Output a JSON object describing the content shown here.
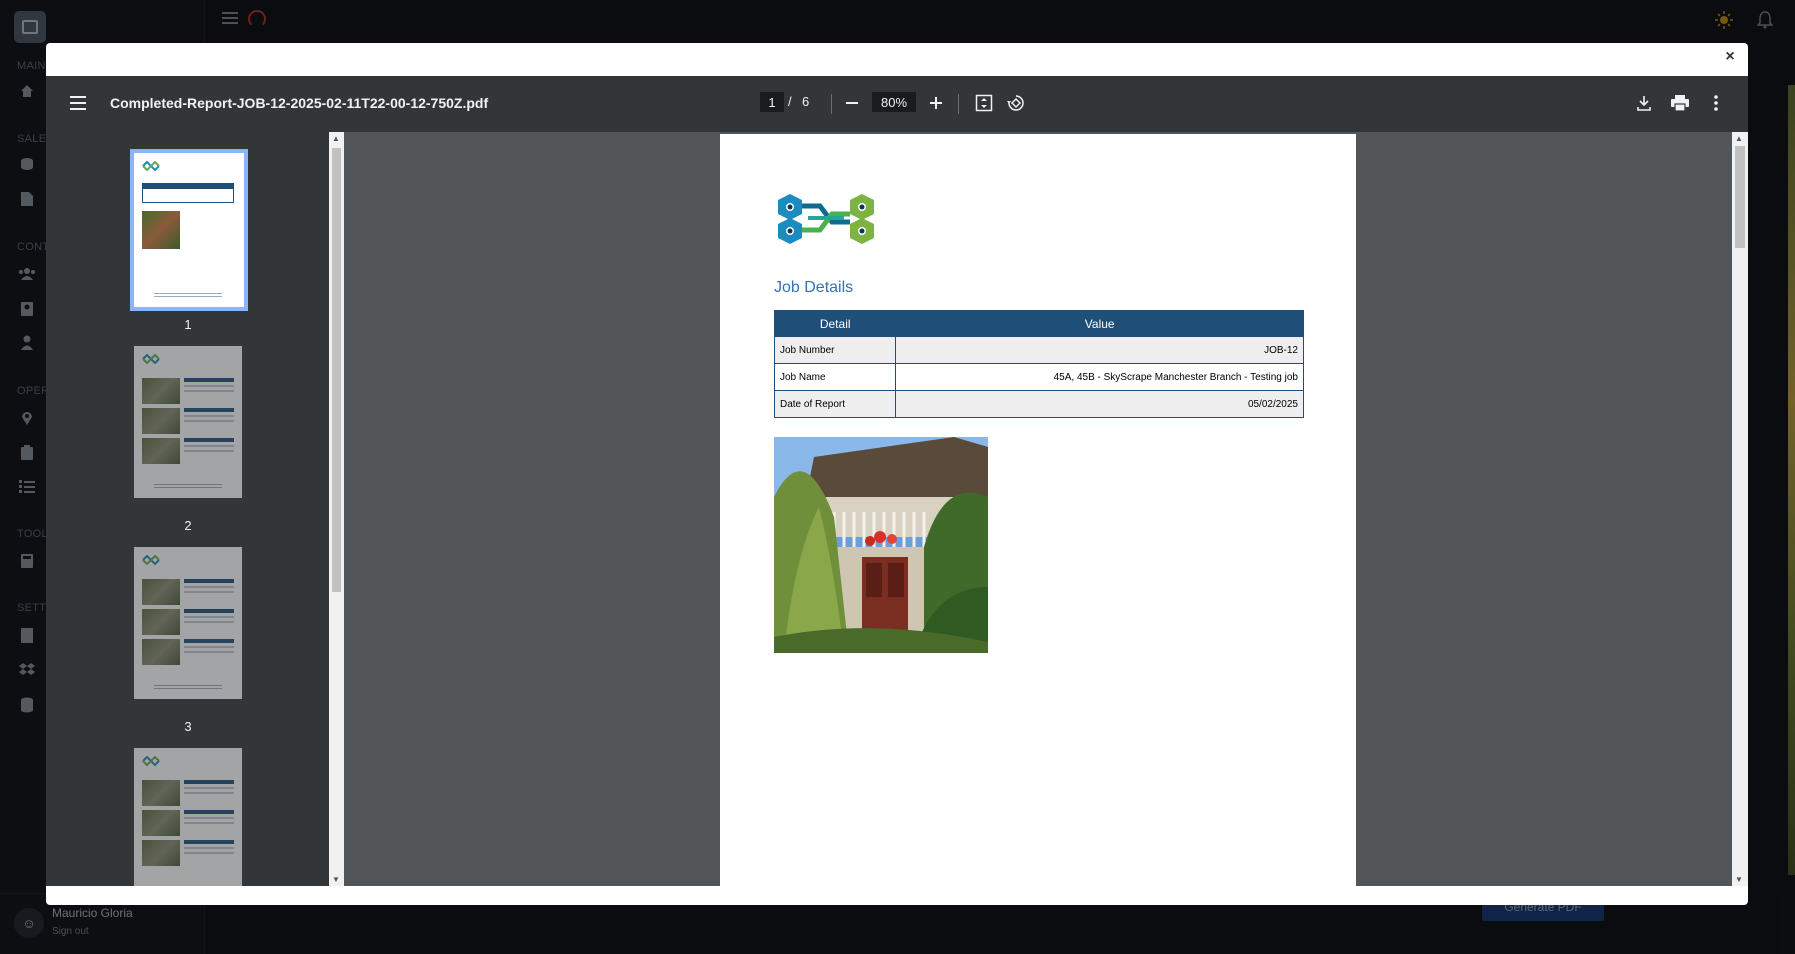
{
  "app": {
    "sections": [
      "MAIN",
      "SALES",
      "CONTA",
      "OPERA",
      "TOOLS",
      "SETTI"
    ],
    "user_name": "Mauricio Gloria",
    "sign_out": "Sign out",
    "generate_pdf": "Generate PDF"
  },
  "modal": {
    "close": "×"
  },
  "viewer": {
    "filename": "Completed-Report-JOB-12-2025-02-11T22-00-12-750Z.pdf",
    "current_page": "1",
    "page_separator": "/",
    "total_pages": "6",
    "zoom": "80%",
    "thumbnails": [
      {
        "label": "1"
      },
      {
        "label": "2"
      },
      {
        "label": "3"
      }
    ]
  },
  "document": {
    "heading": "Job Details",
    "table": {
      "headers": [
        "Detail",
        "Value"
      ],
      "rows": [
        {
          "detail": "Job Number",
          "value": "JOB-12"
        },
        {
          "detail": "Job Name",
          "value": "45A, 45B - SkyScrape Manchester Branch - Testing job"
        },
        {
          "detail": "Date of Report",
          "value": "05/02/2025"
        }
      ]
    }
  },
  "colors": {
    "accent_blue": "#1f4e79",
    "heading_blue": "#2e74b5",
    "viewer_bg": "#525659",
    "toolbar_bg": "#323639",
    "thumb_selected": "#8ab4f8"
  }
}
